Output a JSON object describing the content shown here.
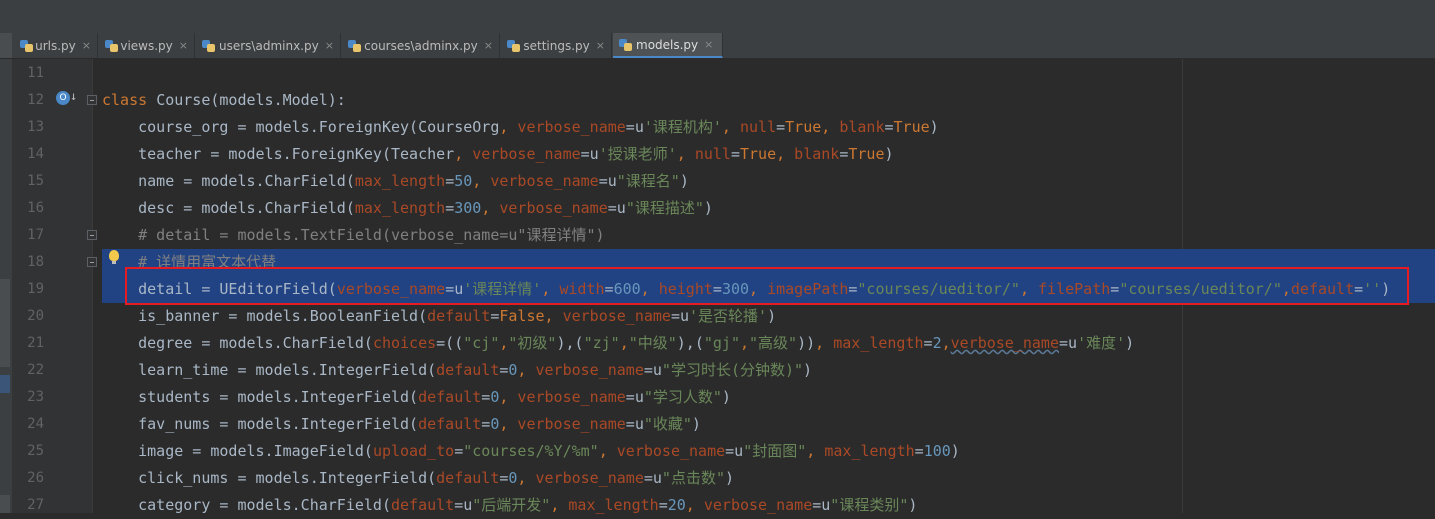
{
  "tabs": [
    {
      "label": "urls.py",
      "close": "×",
      "active": false
    },
    {
      "label": "views.py",
      "close": "×",
      "active": false
    },
    {
      "label": "users\\adminx.py",
      "close": "×",
      "active": false
    },
    {
      "label": "courses\\adminx.py",
      "close": "×",
      "active": false
    },
    {
      "label": "settings.py",
      "close": "×",
      "active": false
    },
    {
      "label": "models.py",
      "close": "×",
      "active": true
    }
  ],
  "gutter_icons": {
    "override": "override-method-icon",
    "bulb": "lightbulb-icon",
    "override_glyph": "O",
    "arrow_glyph": "↓"
  },
  "code_lines": [
    {
      "num": "11",
      "tokens": []
    },
    {
      "num": "12",
      "tokens": [
        {
          "t": "class ",
          "c": "k"
        },
        {
          "t": "Course(models.Model):"
        }
      ]
    },
    {
      "num": "13",
      "tokens": [
        {
          "t": "    course_org = models.ForeignKey(CourseOrg"
        },
        {
          "t": ", ",
          "c": "k"
        },
        {
          "t": "verbose_name",
          "c": "pn"
        },
        {
          "t": "=u"
        },
        {
          "t": "'课程机构'",
          "c": "s"
        },
        {
          "t": ", ",
          "c": "k"
        },
        {
          "t": "null",
          "c": "pn"
        },
        {
          "t": "="
        },
        {
          "t": "True",
          "c": "k"
        },
        {
          "t": ", ",
          "c": "k"
        },
        {
          "t": "blank",
          "c": "pn"
        },
        {
          "t": "="
        },
        {
          "t": "True",
          "c": "k"
        },
        {
          "t": ")"
        }
      ]
    },
    {
      "num": "14",
      "tokens": [
        {
          "t": "    teacher = models.ForeignKey(Teacher"
        },
        {
          "t": ", ",
          "c": "k"
        },
        {
          "t": "verbose_name",
          "c": "pn"
        },
        {
          "t": "=u"
        },
        {
          "t": "'授课老师'",
          "c": "s"
        },
        {
          "t": ", ",
          "c": "k"
        },
        {
          "t": "null",
          "c": "pn"
        },
        {
          "t": "="
        },
        {
          "t": "True",
          "c": "k"
        },
        {
          "t": ", ",
          "c": "k"
        },
        {
          "t": "blank",
          "c": "pn"
        },
        {
          "t": "="
        },
        {
          "t": "True",
          "c": "k"
        },
        {
          "t": ")"
        }
      ]
    },
    {
      "num": "15",
      "tokens": [
        {
          "t": "    name = models.CharField("
        },
        {
          "t": "max_length",
          "c": "pn"
        },
        {
          "t": "="
        },
        {
          "t": "50",
          "c": "n"
        },
        {
          "t": ", ",
          "c": "k"
        },
        {
          "t": "verbose_name",
          "c": "pn"
        },
        {
          "t": "=u"
        },
        {
          "t": "\"课程名\"",
          "c": "s"
        },
        {
          "t": ")"
        }
      ]
    },
    {
      "num": "16",
      "tokens": [
        {
          "t": "    desc = models.CharField("
        },
        {
          "t": "max_length",
          "c": "pn"
        },
        {
          "t": "="
        },
        {
          "t": "300",
          "c": "n"
        },
        {
          "t": ", ",
          "c": "k"
        },
        {
          "t": "verbose_name",
          "c": "pn"
        },
        {
          "t": "=u"
        },
        {
          "t": "\"课程描述\"",
          "c": "s"
        },
        {
          "t": ")"
        }
      ]
    },
    {
      "num": "17",
      "tokens": [
        {
          "t": "    # detail = models.TextField(verbose_name=u\"课程详情\")",
          "c": "cm"
        }
      ]
    },
    {
      "num": "18",
      "sel": true,
      "tokens": [
        {
          "t": "    # 详情用富文本代替",
          "c": "cm"
        }
      ]
    },
    {
      "num": "19",
      "sel": true,
      "tokens": [
        {
          "t": "    detail = UEditorField("
        },
        {
          "t": "verbose_name",
          "c": "pn"
        },
        {
          "t": "=u"
        },
        {
          "t": "'课程详情'",
          "c": "s"
        },
        {
          "t": ", ",
          "c": "k"
        },
        {
          "t": "width",
          "c": "pn"
        },
        {
          "t": "="
        },
        {
          "t": "600",
          "c": "n"
        },
        {
          "t": ", ",
          "c": "k"
        },
        {
          "t": "height",
          "c": "pn"
        },
        {
          "t": "="
        },
        {
          "t": "300",
          "c": "n"
        },
        {
          "t": ", ",
          "c": "k"
        },
        {
          "t": "imagePath",
          "c": "pn"
        },
        {
          "t": "="
        },
        {
          "t": "\"courses/ueditor/\"",
          "c": "s"
        },
        {
          "t": ", ",
          "c": "k"
        },
        {
          "t": "filePath",
          "c": "pn"
        },
        {
          "t": "="
        },
        {
          "t": "\"courses/ueditor/\"",
          "c": "s"
        },
        {
          "t": ",",
          "c": "k"
        },
        {
          "t": "default",
          "c": "pn"
        },
        {
          "t": "="
        },
        {
          "t": "''",
          "c": "s"
        },
        {
          "t": ")"
        }
      ]
    },
    {
      "num": "20",
      "tokens": [
        {
          "t": "    is_banner = models.BooleanField("
        },
        {
          "t": "default",
          "c": "pn"
        },
        {
          "t": "="
        },
        {
          "t": "False",
          "c": "k"
        },
        {
          "t": ", ",
          "c": "k"
        },
        {
          "t": "verbose_name",
          "c": "pn"
        },
        {
          "t": "=u"
        },
        {
          "t": "'是否轮播'",
          "c": "s"
        },
        {
          "t": ")"
        }
      ]
    },
    {
      "num": "21",
      "tokens": [
        {
          "t": "    degree = models.CharField("
        },
        {
          "t": "choices",
          "c": "pn"
        },
        {
          "t": "=(("
        },
        {
          "t": "\"cj\"",
          "c": "s"
        },
        {
          "t": ",",
          "c": "k"
        },
        {
          "t": "\"初级\"",
          "c": "s"
        },
        {
          "t": "),("
        },
        {
          "t": "\"zj\"",
          "c": "s"
        },
        {
          "t": ",",
          "c": "k"
        },
        {
          "t": "\"中级\"",
          "c": "s"
        },
        {
          "t": "),("
        },
        {
          "t": "\"gj\"",
          "c": "s"
        },
        {
          "t": ",",
          "c": "k"
        },
        {
          "t": "\"高级\"",
          "c": "s"
        },
        {
          "t": "))"
        },
        {
          "t": ", ",
          "c": "k"
        },
        {
          "t": "max_length",
          "c": "pn"
        },
        {
          "t": "="
        },
        {
          "t": "2",
          "c": "n"
        },
        {
          "t": ",",
          "c": "k"
        },
        {
          "t": "verbose_name",
          "c": "pn sq"
        },
        {
          "t": "=u"
        },
        {
          "t": "'难度'",
          "c": "s"
        },
        {
          "t": ")"
        }
      ]
    },
    {
      "num": "22",
      "tokens": [
        {
          "t": "    learn_time = models.IntegerField("
        },
        {
          "t": "default",
          "c": "pn"
        },
        {
          "t": "="
        },
        {
          "t": "0",
          "c": "n"
        },
        {
          "t": ", ",
          "c": "k"
        },
        {
          "t": "verbose_name",
          "c": "pn"
        },
        {
          "t": "=u"
        },
        {
          "t": "\"学习时长(分钟数)\"",
          "c": "s"
        },
        {
          "t": ")"
        }
      ]
    },
    {
      "num": "23",
      "tokens": [
        {
          "t": "    students = models.IntegerField("
        },
        {
          "t": "default",
          "c": "pn"
        },
        {
          "t": "="
        },
        {
          "t": "0",
          "c": "n"
        },
        {
          "t": ", ",
          "c": "k"
        },
        {
          "t": "verbose_name",
          "c": "pn"
        },
        {
          "t": "=u"
        },
        {
          "t": "\"学习人数\"",
          "c": "s"
        },
        {
          "t": ")"
        }
      ]
    },
    {
      "num": "24",
      "tokens": [
        {
          "t": "    fav_nums = models.IntegerField("
        },
        {
          "t": "default",
          "c": "pn"
        },
        {
          "t": "="
        },
        {
          "t": "0",
          "c": "n"
        },
        {
          "t": ", ",
          "c": "k"
        },
        {
          "t": "verbose_name",
          "c": "pn"
        },
        {
          "t": "=u"
        },
        {
          "t": "\"收藏\"",
          "c": "s"
        },
        {
          "t": ")"
        }
      ]
    },
    {
      "num": "25",
      "tokens": [
        {
          "t": "    image = models.ImageField("
        },
        {
          "t": "upload_to",
          "c": "pn"
        },
        {
          "t": "="
        },
        {
          "t": "\"courses/%Y/%m\"",
          "c": "s"
        },
        {
          "t": ", ",
          "c": "k"
        },
        {
          "t": "verbose_name",
          "c": "pn"
        },
        {
          "t": "=u"
        },
        {
          "t": "\"封面图\"",
          "c": "s"
        },
        {
          "t": ", ",
          "c": "k"
        },
        {
          "t": "max_length",
          "c": "pn"
        },
        {
          "t": "="
        },
        {
          "t": "100",
          "c": "n"
        },
        {
          "t": ")"
        }
      ]
    },
    {
      "num": "26",
      "tokens": [
        {
          "t": "    click_nums = models.IntegerField("
        },
        {
          "t": "default",
          "c": "pn"
        },
        {
          "t": "="
        },
        {
          "t": "0",
          "c": "n"
        },
        {
          "t": ", ",
          "c": "k"
        },
        {
          "t": "verbose_name",
          "c": "pn"
        },
        {
          "t": "=u"
        },
        {
          "t": "\"点击数\"",
          "c": "s"
        },
        {
          "t": ")"
        }
      ]
    },
    {
      "num": "27",
      "tokens": [
        {
          "t": "    category = models.CharField("
        },
        {
          "t": "default",
          "c": "pn"
        },
        {
          "t": "=u"
        },
        {
          "t": "\"后端开发\"",
          "c": "s"
        },
        {
          "t": ", ",
          "c": "k"
        },
        {
          "t": "max_length",
          "c": "pn"
        },
        {
          "t": "="
        },
        {
          "t": "20",
          "c": "n"
        },
        {
          "t": ", ",
          "c": "k"
        },
        {
          "t": "verbose_name",
          "c": "pn"
        },
        {
          "t": "=u"
        },
        {
          "t": "\"课程类别\"",
          "c": "s"
        },
        {
          "t": ")"
        }
      ]
    }
  ],
  "colors": {
    "editor_bg": "#2b2b2b",
    "gutter_bg": "#313335",
    "selection": "#214283",
    "keyword": "#cc7832",
    "param": "#aa4926",
    "string": "#6a8759",
    "number": "#6897bb",
    "comment": "#808080",
    "highlight_box": "#e81b23"
  }
}
